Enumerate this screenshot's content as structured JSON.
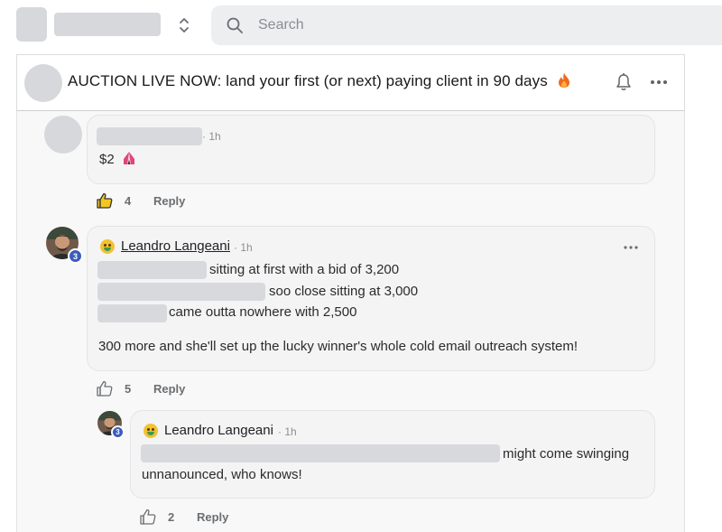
{
  "search": {
    "placeholder": "Search"
  },
  "post": {
    "title": "AUCTION LIVE NOW: land your first (or next) paying client in 90 days",
    "title_emoji": "fire-icon"
  },
  "comments": [
    {
      "time": "· 1h",
      "text": "$2",
      "text_emoji": "circus-tent-icon",
      "like_count": "4",
      "reply_label": "Reply"
    },
    {
      "author": "Leandro Langeani",
      "author_emoji": "money-mouth-face-icon",
      "time": "· 1h",
      "level": "3",
      "lines": [
        "sitting at first with a bid of 3,200",
        "soo close sitting at 3,000",
        "came outta nowhere with 2,500"
      ],
      "paragraph": "300 more and she'll set up the lucky winner's whole cold email outreach system!",
      "like_count": "5",
      "reply_label": "Reply"
    },
    {
      "author": "Leandro Langeani",
      "author_emoji": "money-mouth-face-icon",
      "time": "· 1h",
      "level": "3",
      "line1": "might come swinging",
      "line2": "unnanounced, who knows!",
      "like_count": "2",
      "reply_label": "Reply"
    }
  ],
  "colors": {
    "level_badge": "#3b5bbd",
    "fire": "#f06a1d",
    "bubble": "#f4f4f5"
  }
}
